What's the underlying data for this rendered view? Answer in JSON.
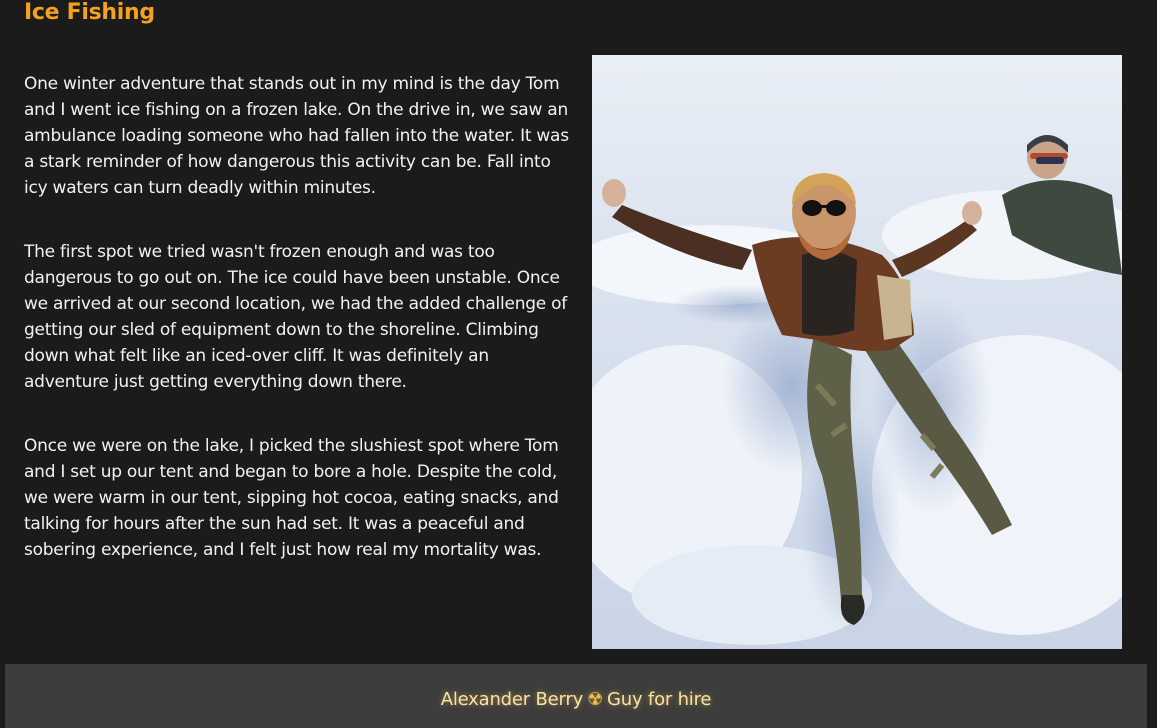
{
  "page": {
    "title": "Ice Fishing"
  },
  "article": {
    "paragraphs": [
      "One winter adventure that stands out in my mind is the day Tom and I went ice fishing on a frozen lake. On the drive in, we saw an ambulance loading someone who had fallen into the water. It was a stark reminder of how dangerous this activity can be. Fall into icy waters can turn deadly within minutes.",
      "The first spot we tried wasn't frozen enough and was too dangerous to go out on. The ice could have been unstable. Once we arrived at our second location, we had the added challenge of getting our sled of equipment down to the shoreline. Climbing down what felt like an iced-over cliff. It was definitely an adventure just getting everything down there.",
      "Once we were on the lake, I picked the slushiest spot where Tom and I set up our tent and began to bore a hole. Despite the cold, we were warm in our tent, sipping hot cocoa, eating snacks, and talking for hours after the sun had set. It was a peaceful and sobering experience, and I felt just how real my mortality was."
    ]
  },
  "photo": {
    "icon": "snow-angel-photo"
  },
  "footer": {
    "name": "Alexander Berry",
    "separator_icon": "☢",
    "tagline": "Guy for hire"
  },
  "colors": {
    "background": "#1b1b1b",
    "title": "#f5a01e",
    "body_text": "#f2f2f2",
    "footer_bg": "#3d3d3d",
    "footer_text": "#f7e3a6"
  }
}
